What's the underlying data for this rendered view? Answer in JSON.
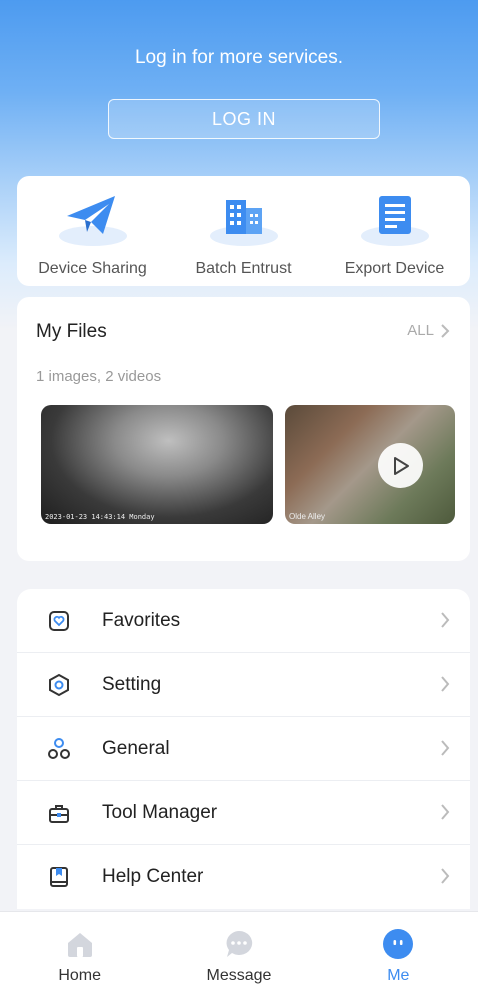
{
  "header": {
    "prompt": "Log in for more services.",
    "login_label": "LOG IN"
  },
  "quick_actions": [
    {
      "label": "Device Sharing",
      "icon": "paper-plane-icon"
    },
    {
      "label": "Batch Entrust",
      "icon": "buildings-icon"
    },
    {
      "label": "Export Device",
      "icon": "document-list-icon"
    }
  ],
  "files": {
    "title": "My Files",
    "all_label": "ALL",
    "summary": "1 images, 2 videos",
    "thumbs": [
      {
        "timestamp": "2023-01-23 14:43:14 Monday",
        "type": "image"
      },
      {
        "timestamp": "Olde Alley",
        "type": "video"
      }
    ]
  },
  "menu": [
    {
      "label": "Favorites",
      "icon": "favorites-icon"
    },
    {
      "label": "Setting",
      "icon": "hexagon-settings-icon"
    },
    {
      "label": "General",
      "icon": "general-circles-icon"
    },
    {
      "label": "Tool Manager",
      "icon": "toolbox-icon"
    },
    {
      "label": "Help Center",
      "icon": "book-icon"
    }
  ],
  "tabs": [
    {
      "label": "Home",
      "icon": "home-icon",
      "active": false
    },
    {
      "label": "Message",
      "icon": "message-icon",
      "active": false
    },
    {
      "label": "Me",
      "icon": "me-icon",
      "active": true
    }
  ],
  "colors": {
    "accent": "#3d8cf0",
    "hero_top": "#4d9bf0",
    "background": "#f2f3f7"
  }
}
